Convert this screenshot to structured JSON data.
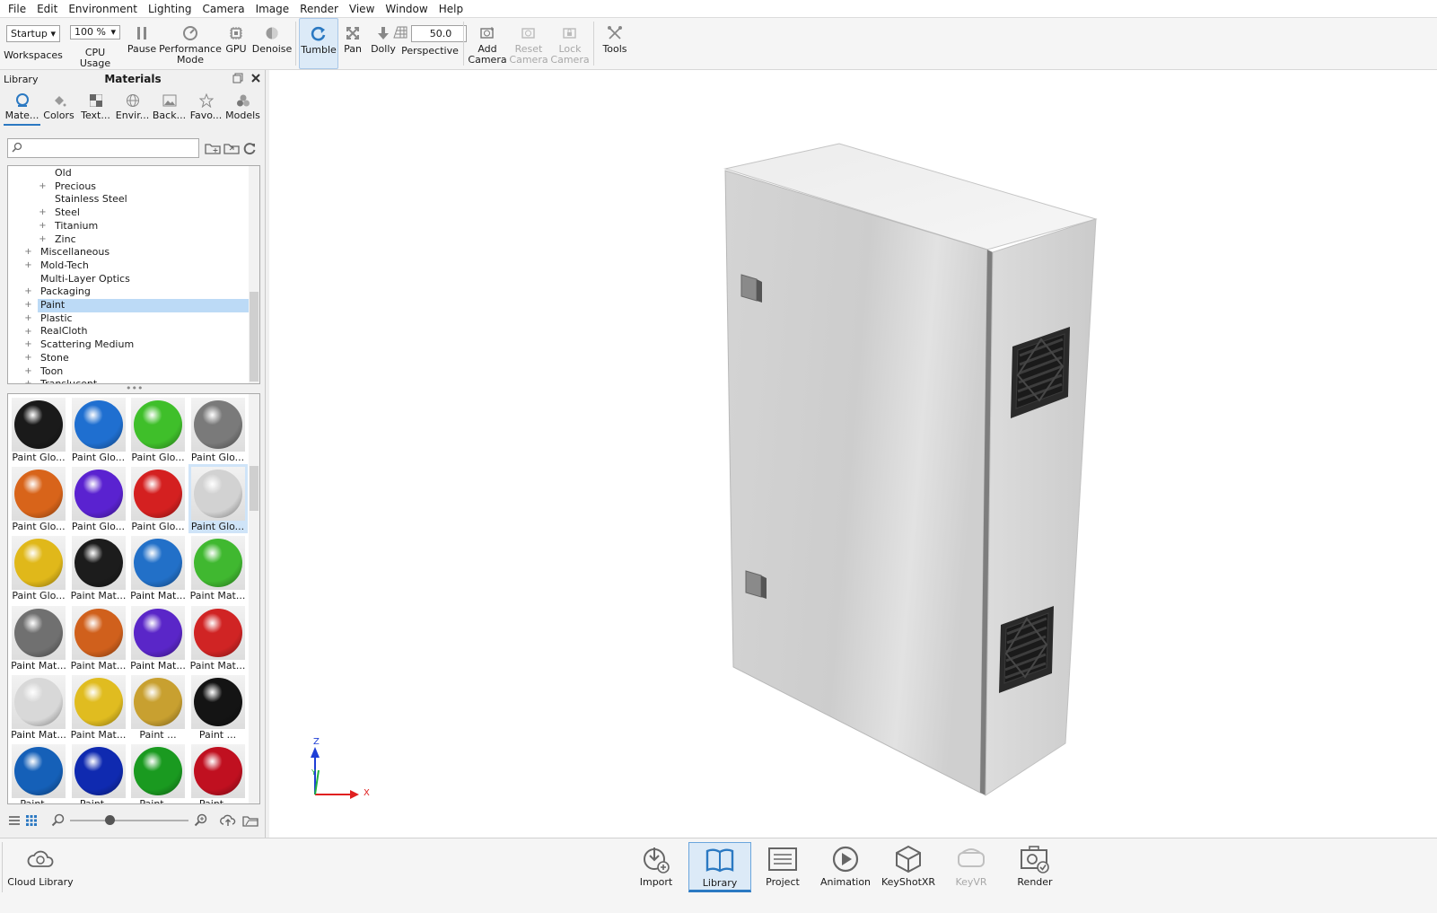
{
  "menu": [
    "File",
    "Edit",
    "Environment",
    "Lighting",
    "Camera",
    "Image",
    "Render",
    "View",
    "Window",
    "Help"
  ],
  "toolbar": {
    "workspace_value": "Startup",
    "workspaces_label": "Workspaces",
    "cpu_value": "100 %",
    "cpu_label": "CPU Usage",
    "pause_label": "Pause",
    "performance_label_1": "Performance",
    "performance_label_2": "Mode",
    "gpu_label": "GPU",
    "denoise_label": "Denoise",
    "tumble_label": "Tumble",
    "pan_label": "Pan",
    "dolly_label": "Dolly",
    "fov_value": "50.0",
    "perspective_label": "Perspective",
    "add_camera_1": "Add",
    "add_camera_2": "Camera",
    "reset_camera_1": "Reset",
    "reset_camera_2": "Camera",
    "lock_camera_1": "Lock",
    "lock_camera_2": "Camera",
    "tools_label": "Tools",
    "accent": "#2b79c2"
  },
  "library": {
    "header_left": "Library",
    "header_title": "Materials",
    "tabs": [
      "Mate...",
      "Colors",
      "Text...",
      "Envir...",
      "Back...",
      "Favo...",
      "Models"
    ],
    "search_placeholder": "",
    "tree": [
      {
        "label": "Old",
        "level": 2,
        "expand": false,
        "selected": false
      },
      {
        "label": "Precious",
        "level": 2,
        "expand": true,
        "selected": false
      },
      {
        "label": "Stainless Steel",
        "level": 2,
        "expand": false,
        "selected": false
      },
      {
        "label": "Steel",
        "level": 2,
        "expand": true,
        "selected": false
      },
      {
        "label": "Titanium",
        "level": 2,
        "expand": true,
        "selected": false
      },
      {
        "label": "Zinc",
        "level": 2,
        "expand": true,
        "selected": false
      },
      {
        "label": "Miscellaneous",
        "level": 1,
        "expand": true,
        "selected": false
      },
      {
        "label": "Mold-Tech",
        "level": 1,
        "expand": true,
        "selected": false
      },
      {
        "label": "Multi-Layer Optics",
        "level": 1,
        "expand": false,
        "selected": false
      },
      {
        "label": "Packaging",
        "level": 1,
        "expand": true,
        "selected": false
      },
      {
        "label": "Paint",
        "level": 1,
        "expand": true,
        "selected": true
      },
      {
        "label": "Plastic",
        "level": 1,
        "expand": true,
        "selected": false
      },
      {
        "label": "RealCloth",
        "level": 1,
        "expand": true,
        "selected": false
      },
      {
        "label": "Scattering Medium",
        "level": 1,
        "expand": true,
        "selected": false
      },
      {
        "label": "Stone",
        "level": 1,
        "expand": true,
        "selected": false
      },
      {
        "label": "Toon",
        "level": 1,
        "expand": true,
        "selected": false
      },
      {
        "label": "Translucent",
        "level": 1,
        "expand": true,
        "selected": false
      }
    ],
    "materials": [
      {
        "label": "Paint Glo...",
        "color": "#1a1a1a",
        "selected": false
      },
      {
        "label": "Paint Glo...",
        "color": "#1f6fd0",
        "selected": false
      },
      {
        "label": "Paint Glo...",
        "color": "#3fbf2a",
        "selected": false
      },
      {
        "label": "Paint Glo...",
        "color": "#7a7a7a",
        "selected": false
      },
      {
        "label": "Paint Glo...",
        "color": "#d8641a",
        "selected": false
      },
      {
        "label": "Paint Glo...",
        "color": "#5a22d0",
        "selected": false
      },
      {
        "label": "Paint Glo...",
        "color": "#d42020",
        "selected": false
      },
      {
        "label": "Paint Glo...",
        "color": "#d2d2d2",
        "selected": true
      },
      {
        "label": "Paint Glo...",
        "color": "#e0b81a",
        "selected": false
      },
      {
        "label": "Paint Mat...",
        "color": "#1c1c1c",
        "selected": false
      },
      {
        "label": "Paint Mat...",
        "color": "#2270c8",
        "selected": false
      },
      {
        "label": "Paint Mat...",
        "color": "#40b830",
        "selected": false
      },
      {
        "label": "Paint Mat...",
        "color": "#707070",
        "selected": false
      },
      {
        "label": "Paint Mat...",
        "color": "#d0601c",
        "selected": false
      },
      {
        "label": "Paint Mat...",
        "color": "#5a26c8",
        "selected": false
      },
      {
        "label": "Paint Mat...",
        "color": "#d02424",
        "selected": false
      },
      {
        "label": "Paint Mat...",
        "color": "#d8d8d8",
        "selected": false
      },
      {
        "label": "Paint Mat...",
        "color": "#e0bc20",
        "selected": false
      },
      {
        "label": "Paint ...",
        "color": "#c8a030",
        "selected": false
      },
      {
        "label": "Paint ...",
        "color": "#141414",
        "selected": false
      },
      {
        "label": "Paint ...",
        "color": "#1560b8",
        "selected": false
      },
      {
        "label": "Paint ...",
        "color": "#0f2ab0",
        "selected": false
      },
      {
        "label": "Paint ...",
        "color": "#1a9a20",
        "selected": false
      },
      {
        "label": "Paint ...",
        "color": "#c01020",
        "selected": false
      }
    ]
  },
  "viewport": {
    "axis_z": "Z",
    "axis_x": "X",
    "axis_y": "Y"
  },
  "bottombar": {
    "cloud_library": "Cloud Library",
    "items": [
      "Import",
      "Library",
      "Project",
      "Animation",
      "KeyShotXR",
      "KeyVR",
      "Render"
    ],
    "active_index": 1,
    "disabled_index": 5
  }
}
